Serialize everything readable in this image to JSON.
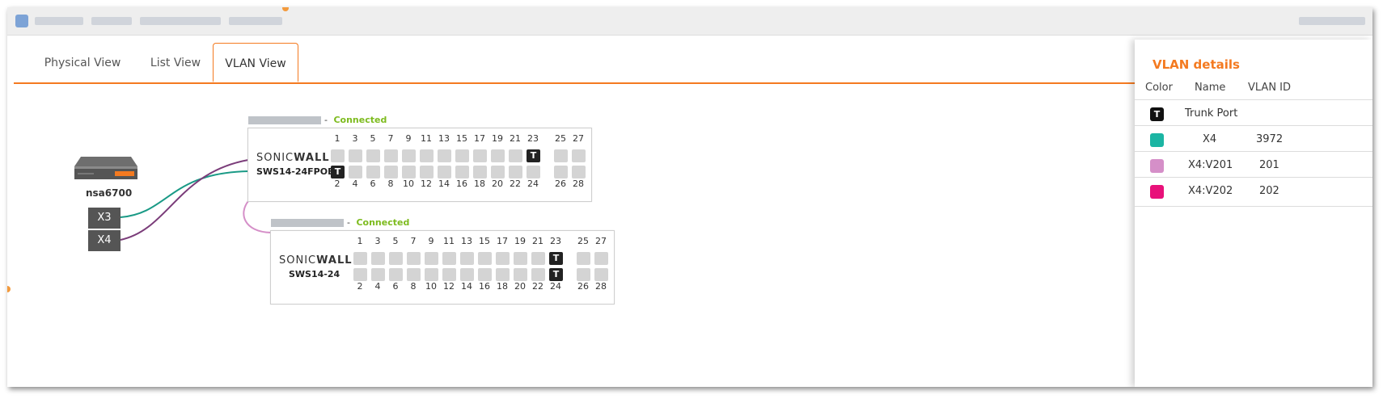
{
  "tabs": [
    "Physical View",
    "List View",
    "VLAN View"
  ],
  "firewall": {
    "name": "nsa6700",
    "ports": [
      "X3",
      "X4"
    ]
  },
  "switches": [
    {
      "status": "Connected",
      "brand_light": "SONIC",
      "brand_bold": "WALL",
      "model": "SWS14-24FPOE",
      "top_numbers": [
        "1",
        "3",
        "5",
        "7",
        "9",
        "11",
        "13",
        "15",
        "17",
        "19",
        "21",
        "23",
        "25",
        "27"
      ],
      "bottom_numbers": [
        "2",
        "4",
        "6",
        "8",
        "10",
        "12",
        "14",
        "16",
        "18",
        "20",
        "22",
        "24",
        "26",
        "28"
      ],
      "trunk_label": "T",
      "trunk_ports": [
        "23",
        "2"
      ]
    },
    {
      "status": "Connected",
      "brand_light": "SONIC",
      "brand_bold": "WALL",
      "model": "SWS14-24",
      "top_numbers": [
        "1",
        "3",
        "5",
        "7",
        "9",
        "11",
        "13",
        "15",
        "17",
        "19",
        "21",
        "23",
        "25",
        "27"
      ],
      "bottom_numbers": [
        "2",
        "4",
        "6",
        "8",
        "10",
        "12",
        "14",
        "16",
        "18",
        "20",
        "22",
        "24",
        "26",
        "28"
      ],
      "trunk_label": "T",
      "trunk_ports": [
        "23",
        "24"
      ]
    }
  ],
  "vlan_details": {
    "title": "VLAN details",
    "headers": {
      "color": "Color",
      "name": "Name",
      "vlan_id": "VLAN ID"
    },
    "rows": [
      {
        "color": "#111111",
        "swatch_label": "T",
        "name": "Trunk Port",
        "vlan_id": ""
      },
      {
        "color": "#1bb5a3",
        "name": "X4",
        "vlan_id": "3972"
      },
      {
        "color": "#d58fc8",
        "name": "X4:V201",
        "vlan_id": "201"
      },
      {
        "color": "#e8117a",
        "name": "X4:V202",
        "vlan_id": "202"
      }
    ]
  },
  "colors": {
    "accent": "#f47a20",
    "connected": "#7dbb1e",
    "link_x3": "#1a9a86",
    "link_x4": "#7b3d7a",
    "link_switch": "#d58fc8"
  }
}
